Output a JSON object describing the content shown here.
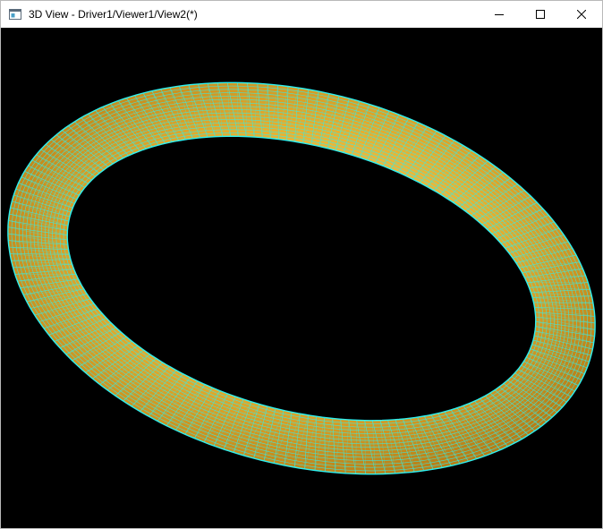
{
  "window": {
    "title": "3D View - Driver1/Viewer1/View2(*)",
    "app_icon": "window-app-icon",
    "controls": {
      "minimize_icon": "minimize-icon",
      "maximize_icon": "maximize-icon",
      "close_icon": "close-icon"
    }
  },
  "viewer": {
    "background_color": "#000000",
    "model": "torus",
    "display_mode": "shaded-with-wireframe",
    "surface_color": "#e8b030",
    "wire_color": "#2ef0f0"
  }
}
